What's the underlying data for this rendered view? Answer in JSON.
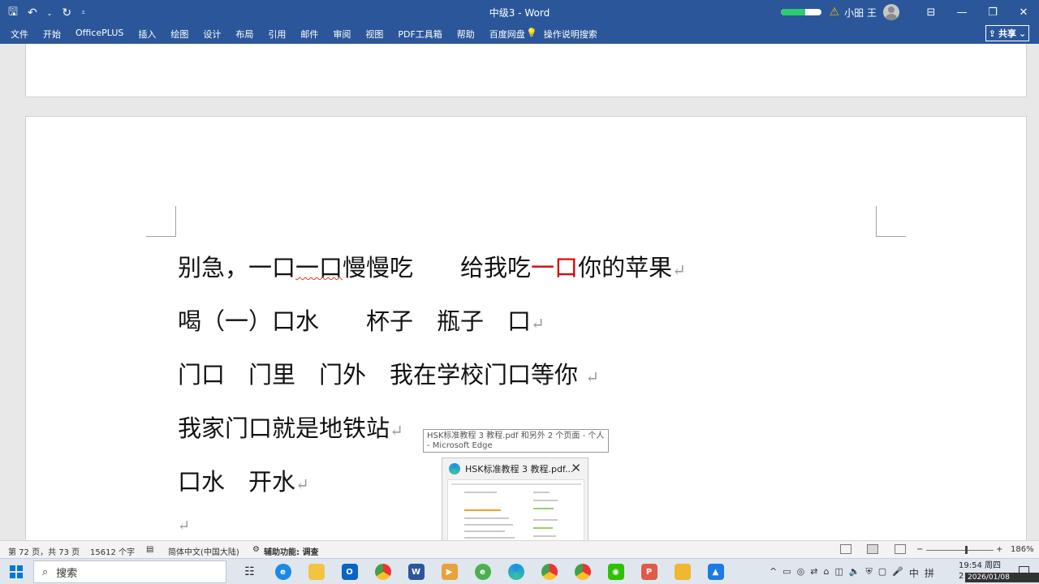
{
  "window": {
    "title": "中级3 - Word",
    "user": "小昍 王",
    "sync_progress": 0.6
  },
  "ribbon": {
    "tabs": [
      "文件",
      "开始",
      "OfficePLUS",
      "插入",
      "绘图",
      "设计",
      "布局",
      "引用",
      "邮件",
      "审阅",
      "视图",
      "PDF工具箱",
      "帮助",
      "百度网盘"
    ],
    "tell_me": "操作说明搜索",
    "share": "共享"
  },
  "document": {
    "lines": [
      {
        "a": "别急，一口",
        "b": "一口",
        "c": "慢慢吃　　给我吃",
        "red": "一口",
        "d": "你的苹果",
        "mark": "↵"
      },
      {
        "text": "喝（一）口水　　杯子　瓶子　口",
        "mark": "↵"
      },
      {
        "text": "门口　门里　门外　我在学校门口等你 ",
        "mark": "↵"
      },
      {
        "text": "我家门口就是地铁站",
        "mark": "↵"
      },
      {
        "text": "口水　开水",
        "mark": "↵"
      }
    ],
    "trailing_mark": "↵"
  },
  "tooltip": {
    "text": "HSK标准教程 3 教程.pdf 和另外 2 个页面 - 个人 - Microsoft Edge"
  },
  "thumbnail": {
    "title": "HSK标准教程 3 教程.pdf..."
  },
  "status": {
    "page": "第 72 页，共 73 页",
    "words": "15612 个字",
    "language": "简体中文(中国大陆)",
    "accessibility": "辅助功能: 调查",
    "zoom_minus": "−",
    "zoom_plus": "+",
    "zoom": "186%"
  },
  "taskbar": {
    "search_placeholder": "搜索",
    "ime": "中",
    "ime2": "拼",
    "time": "19:54 周四",
    "date_fragment": "2",
    "screenshot_stamp": "2026/01/08 19:54:39"
  }
}
